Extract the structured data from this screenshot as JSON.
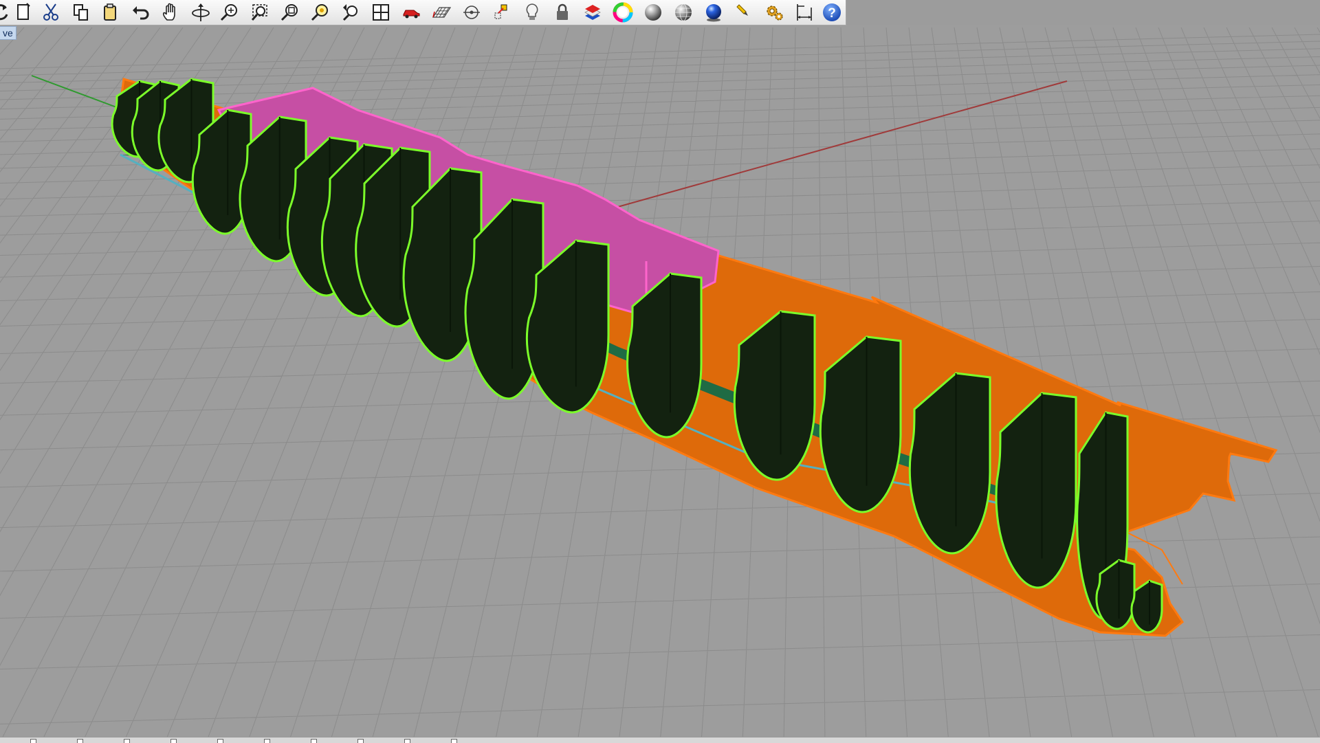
{
  "viewport": {
    "label": "ve"
  },
  "toolbar": {
    "buttons": [
      "rotate-view-icon",
      "new-icon",
      "cut-icon",
      "copy-icon",
      "paste-icon",
      "undo-icon",
      "pan-icon",
      "rotate-icon",
      "zoom-dynamic-icon",
      "zoom-window-icon",
      "zoom-extents-icon",
      "zoom-selected-icon",
      "undo-view-icon",
      "four-viewports-icon",
      "car-icon",
      "grid-icon",
      "osnap-icon",
      "move-gumball-icon",
      "light-icon",
      "lock-icon",
      "layers-icon",
      "color-wheel-icon",
      "shaded-sphere-icon",
      "wireframe-sphere-icon",
      "rendered-sphere-icon",
      "pencil-icon",
      "options-gear-icon",
      "dimension-icon",
      "help-icon"
    ]
  },
  "statusbar": {
    "osnaps": [
      "",
      "",
      "",
      "",
      "",
      "",
      "",
      "",
      "",
      ""
    ]
  },
  "colors": {
    "viewport_bg": "#9c9c9c",
    "grid": "#8a8a8a",
    "x_axis": "#a03030",
    "y_axis": "#30a030",
    "frame_fill": "#132210",
    "frame_edge": "#7cff2a",
    "keel_fill": "#e06a08",
    "deck_fill": "#1f6b44",
    "stringer_fill": "#c94fa6",
    "stringer_edge": "#ff5ecb"
  }
}
